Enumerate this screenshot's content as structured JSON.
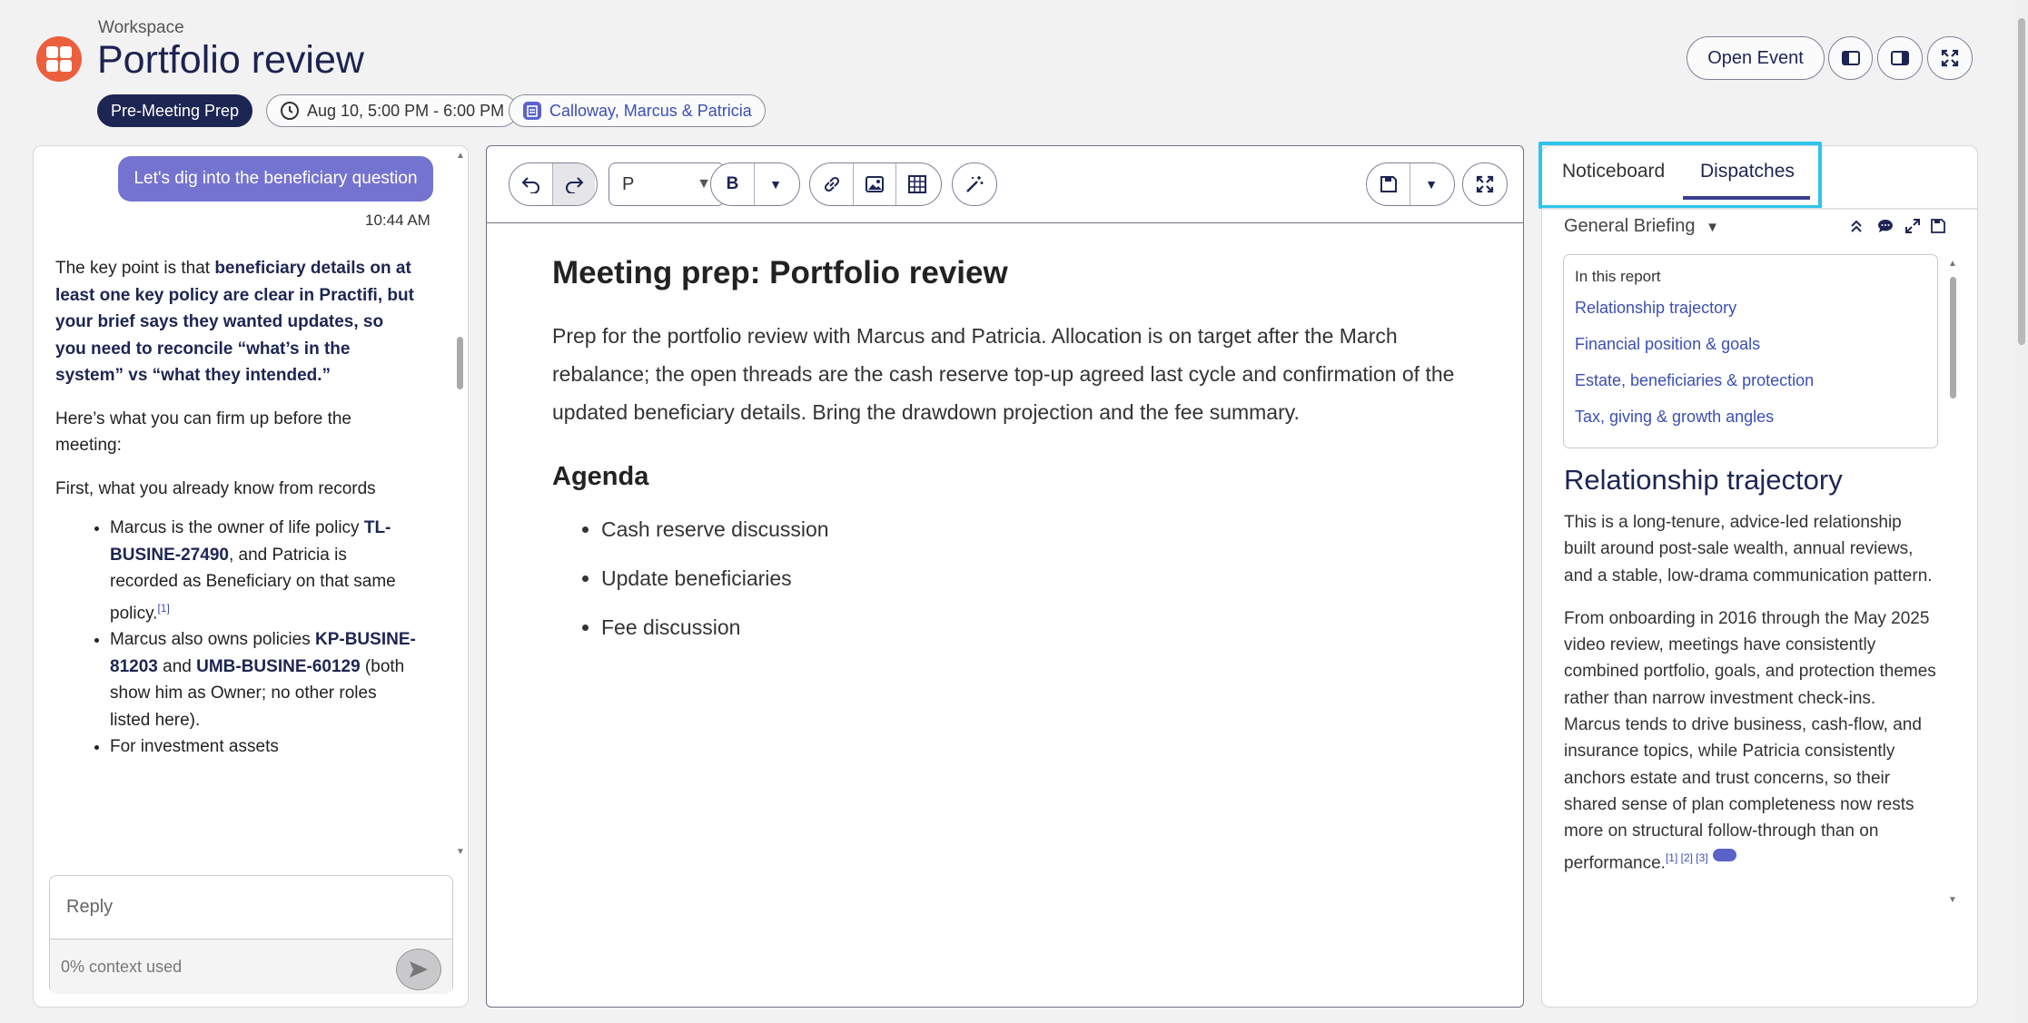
{
  "header": {
    "workspace_label": "Workspace",
    "title": "Portfolio review",
    "chips": {
      "stage": "Pre-Meeting Prep",
      "time": "Aug 10, 5:00 PM - 6:00 PM",
      "client": "Calloway, Marcus & Patricia"
    },
    "open_event_label": "Open Event",
    "logo_color": "#ec5f3d"
  },
  "chat": {
    "user_message": "Let's dig into the beneficiary question",
    "user_message_time": "10:44 AM",
    "reply_placeholder": "Reply",
    "context_used": "0% context used"
  },
  "editor": {
    "format_value": "P",
    "doc_title": "Meeting prep: Portfolio review",
    "doc_intro": "Prep for the portfolio review with Marcus and Patricia. Allocation is on target after the March rebalance; the open threads are the cash reserve top-up agreed last cycle and confirmation of the updated beneficiary details. Bring the drawdown projection and the fee summary.",
    "agenda_heading": "Agenda",
    "agenda": [
      "Cash reserve discussion",
      "Update beneficiaries",
      "Fee discussion"
    ]
  },
  "right_panel": {
    "tabs": [
      "Noticeboard",
      "Dispatches"
    ],
    "active_tab": "Dispatches",
    "briefing_select": "General Briefing",
    "toc_title": "In this report",
    "toc": [
      "Relationship trajectory",
      "Financial position & goals",
      "Estate, beneficiaries & protection",
      "Tax, giving & growth angles"
    ],
    "section_title": "Relationship trajectory",
    "p1": "This is a long-tenure, advice-led relationship built around post-sale wealth, annual reviews, and a stable, low-drama communication pattern.",
    "p2": "From onboarding in 2016 through the May 2025 video review, meetings have consistently combined portfolio, goals, and protection themes rather than narrow investment check-ins. Marcus tends to drive business, cash-flow, and insurance topics, while Patricia consistently anchors estate and trust concerns, so their shared sense of plan completeness now rests more on structural follow-through than on performance.",
    "citations": "[1] [2] [3]"
  },
  "colors": {
    "accent": "#3c4fb3",
    "navy": "#1d2553",
    "user_bubble": "#7474d0",
    "highlight": "#2ec4ef"
  }
}
